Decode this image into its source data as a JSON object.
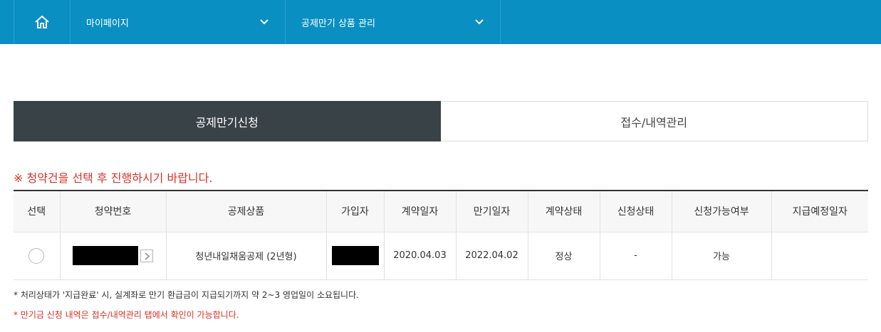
{
  "nav": {
    "menu1": "마이페이지",
    "menu2": "공제만기 상품 관리"
  },
  "tabs": [
    {
      "label": "공제만기신청",
      "active": true
    },
    {
      "label": "접수/내역관리",
      "active": false
    }
  ],
  "notice": "※ 청약건을 선택 후 진행하시기 바랍니다.",
  "table": {
    "headers": [
      "선택",
      "청약번호",
      "공제상품",
      "가입자",
      "계약일자",
      "만기일자",
      "계약상태",
      "신청상태",
      "신청가능여부",
      "지급예정일자"
    ],
    "rows": [
      {
        "product": "청년내일채움공제 (2년형)",
        "contract_date": "2020.04.03",
        "maturity_date": "2022.04.02",
        "contract_status": "정상",
        "apply_status": "-",
        "available": "가능",
        "payment_date": ""
      }
    ]
  },
  "footnotes": {
    "line1": "* 처리상태가 '지급완료' 시, 실계좌로 만기 환급금이 지급되기까지 약 2~3 영업일이 소요됩니다.",
    "line2": "* 만기금 신청 내역은 접수/내역관리 탭에서 확인이 가능합니다."
  },
  "colors": {
    "topbar": "#0a8fc2",
    "active_tab": "#394247",
    "notice_red": "#d93025"
  }
}
